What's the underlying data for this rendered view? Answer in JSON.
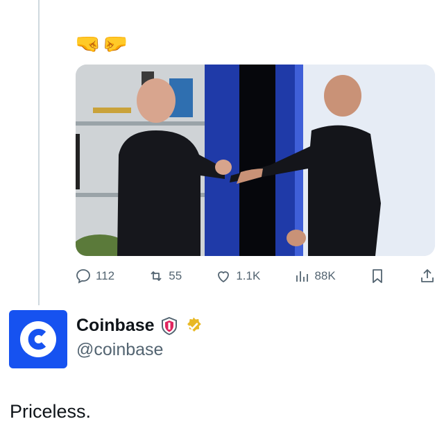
{
  "tweet_above": {
    "emojis": "🤜🤛",
    "media": {
      "description_icon": "video-still-icon"
    },
    "actions": {
      "replies": "112",
      "reposts": "55",
      "likes": "1.1K",
      "views": "88K"
    }
  },
  "author": {
    "display_name": "Coinbase",
    "handle": "@coinbase",
    "avatar_icon": "coinbase-logo-icon",
    "badges": [
      "shield-affiliate-icon",
      "verified-gold-icon"
    ]
  },
  "tweet": {
    "text": "Priceless."
  },
  "colors": {
    "brand_blue": "#1652f0",
    "secondary_text": "#536471",
    "verified_gold": "#e8b824"
  }
}
